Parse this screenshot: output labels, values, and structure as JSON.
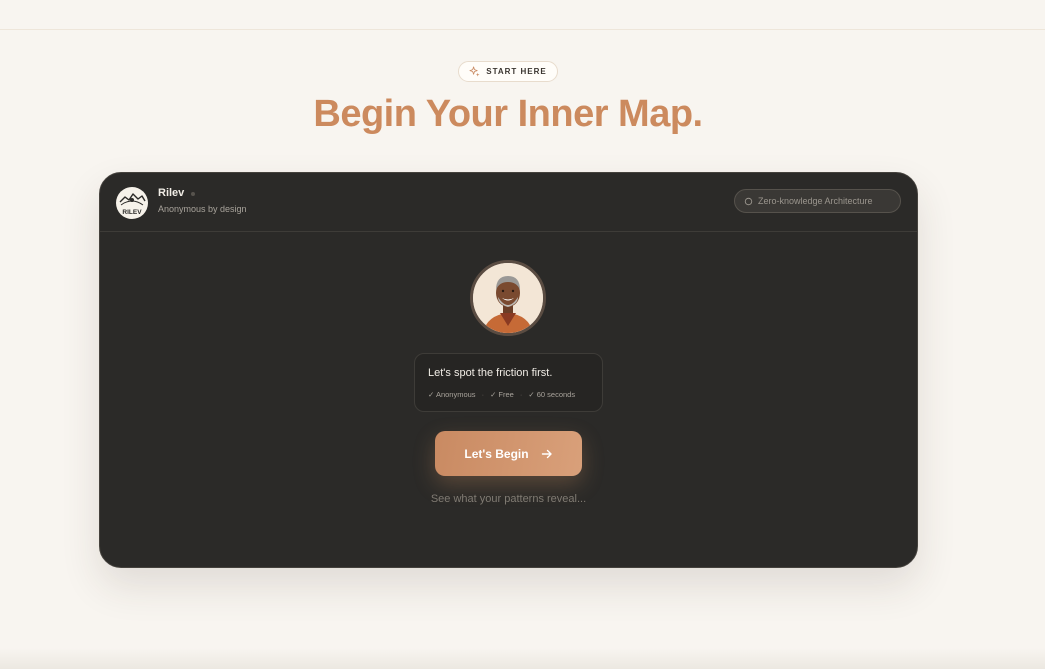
{
  "hero": {
    "eyebrow": "START HERE",
    "eyebrow_icon": "sparkles-icon",
    "title": "Begin Your Inner Map."
  },
  "card": {
    "brand": {
      "name": "Rilev",
      "tagline": "Anonymous by design",
      "logo_text": "RILEV"
    },
    "badge": {
      "icon": "shield-icon",
      "label": "Zero-knowledge Architecture"
    },
    "guide_avatar": "guide-avatar-illustration",
    "prompt": {
      "title": "Let's spot the friction first.",
      "tags": [
        "✓ Anonymous",
        "✓ Free",
        "✓ 60 seconds"
      ],
      "separator": "·"
    },
    "cta": {
      "label": "Let's Begin",
      "icon": "arrow-right-icon"
    },
    "hint": "See what your patterns reveal..."
  },
  "colors": {
    "page_background": "#f8f5f0",
    "accent": "#cc8a5e",
    "card_background": "#2b2a28",
    "cta_gradient_start": "#c98a62",
    "cta_gradient_end": "#d9a07a"
  }
}
